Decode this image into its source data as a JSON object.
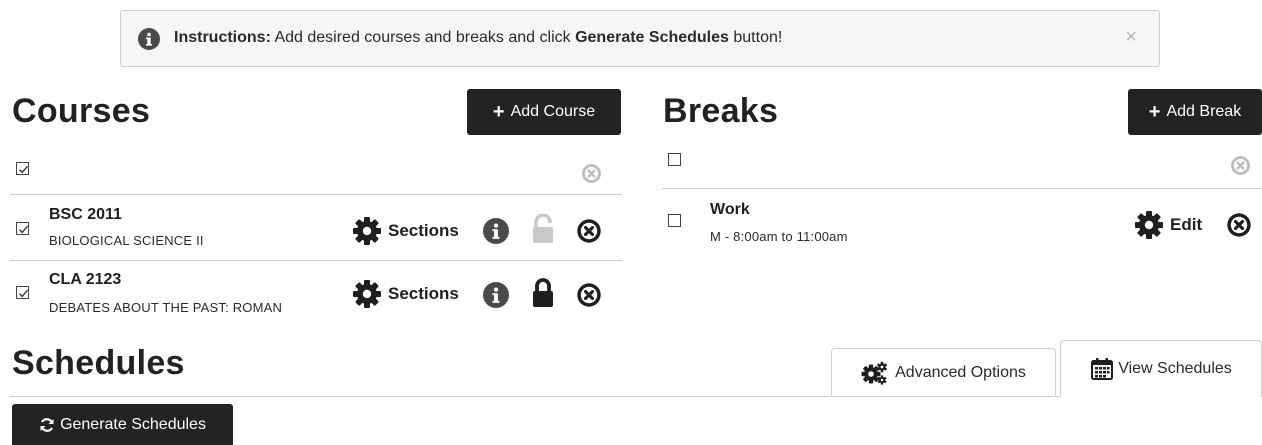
{
  "instructions": {
    "label": "Instructions:",
    "text_before": "Add desired courses and breaks and click",
    "emphasis": "Generate Schedules",
    "text_after": "button!",
    "close_glyph": "×"
  },
  "courses": {
    "title": "Courses",
    "add_button": "Add Course",
    "select_all_checked": true,
    "items": [
      {
        "code": "BSC 2011",
        "name": "BIOLOGICAL SCIENCE II",
        "checked": true,
        "sections_label": "Sections",
        "locked": false
      },
      {
        "code": "CLA 2123",
        "name": "DEBATES ABOUT THE PAST: ROMAN",
        "checked": true,
        "sections_label": "Sections",
        "locked": true
      }
    ]
  },
  "breaks": {
    "title": "Breaks",
    "add_button": "Add Break",
    "select_all_checked": false,
    "items": [
      {
        "name": "Work",
        "time": "M - 8:00am to 11:00am",
        "checked": false,
        "edit_label": "Edit"
      }
    ]
  },
  "schedules": {
    "title": "Schedules",
    "tabs": [
      {
        "label": "Advanced Options",
        "icon": "gears-icon",
        "active": false
      },
      {
        "label": "View Schedules",
        "icon": "calendar-icon",
        "active": true
      }
    ],
    "generate_button": "Generate Schedules"
  },
  "colors": {
    "dark": "#232323",
    "muted_icon": "#bdbdbd",
    "border": "#cfcfcf"
  }
}
